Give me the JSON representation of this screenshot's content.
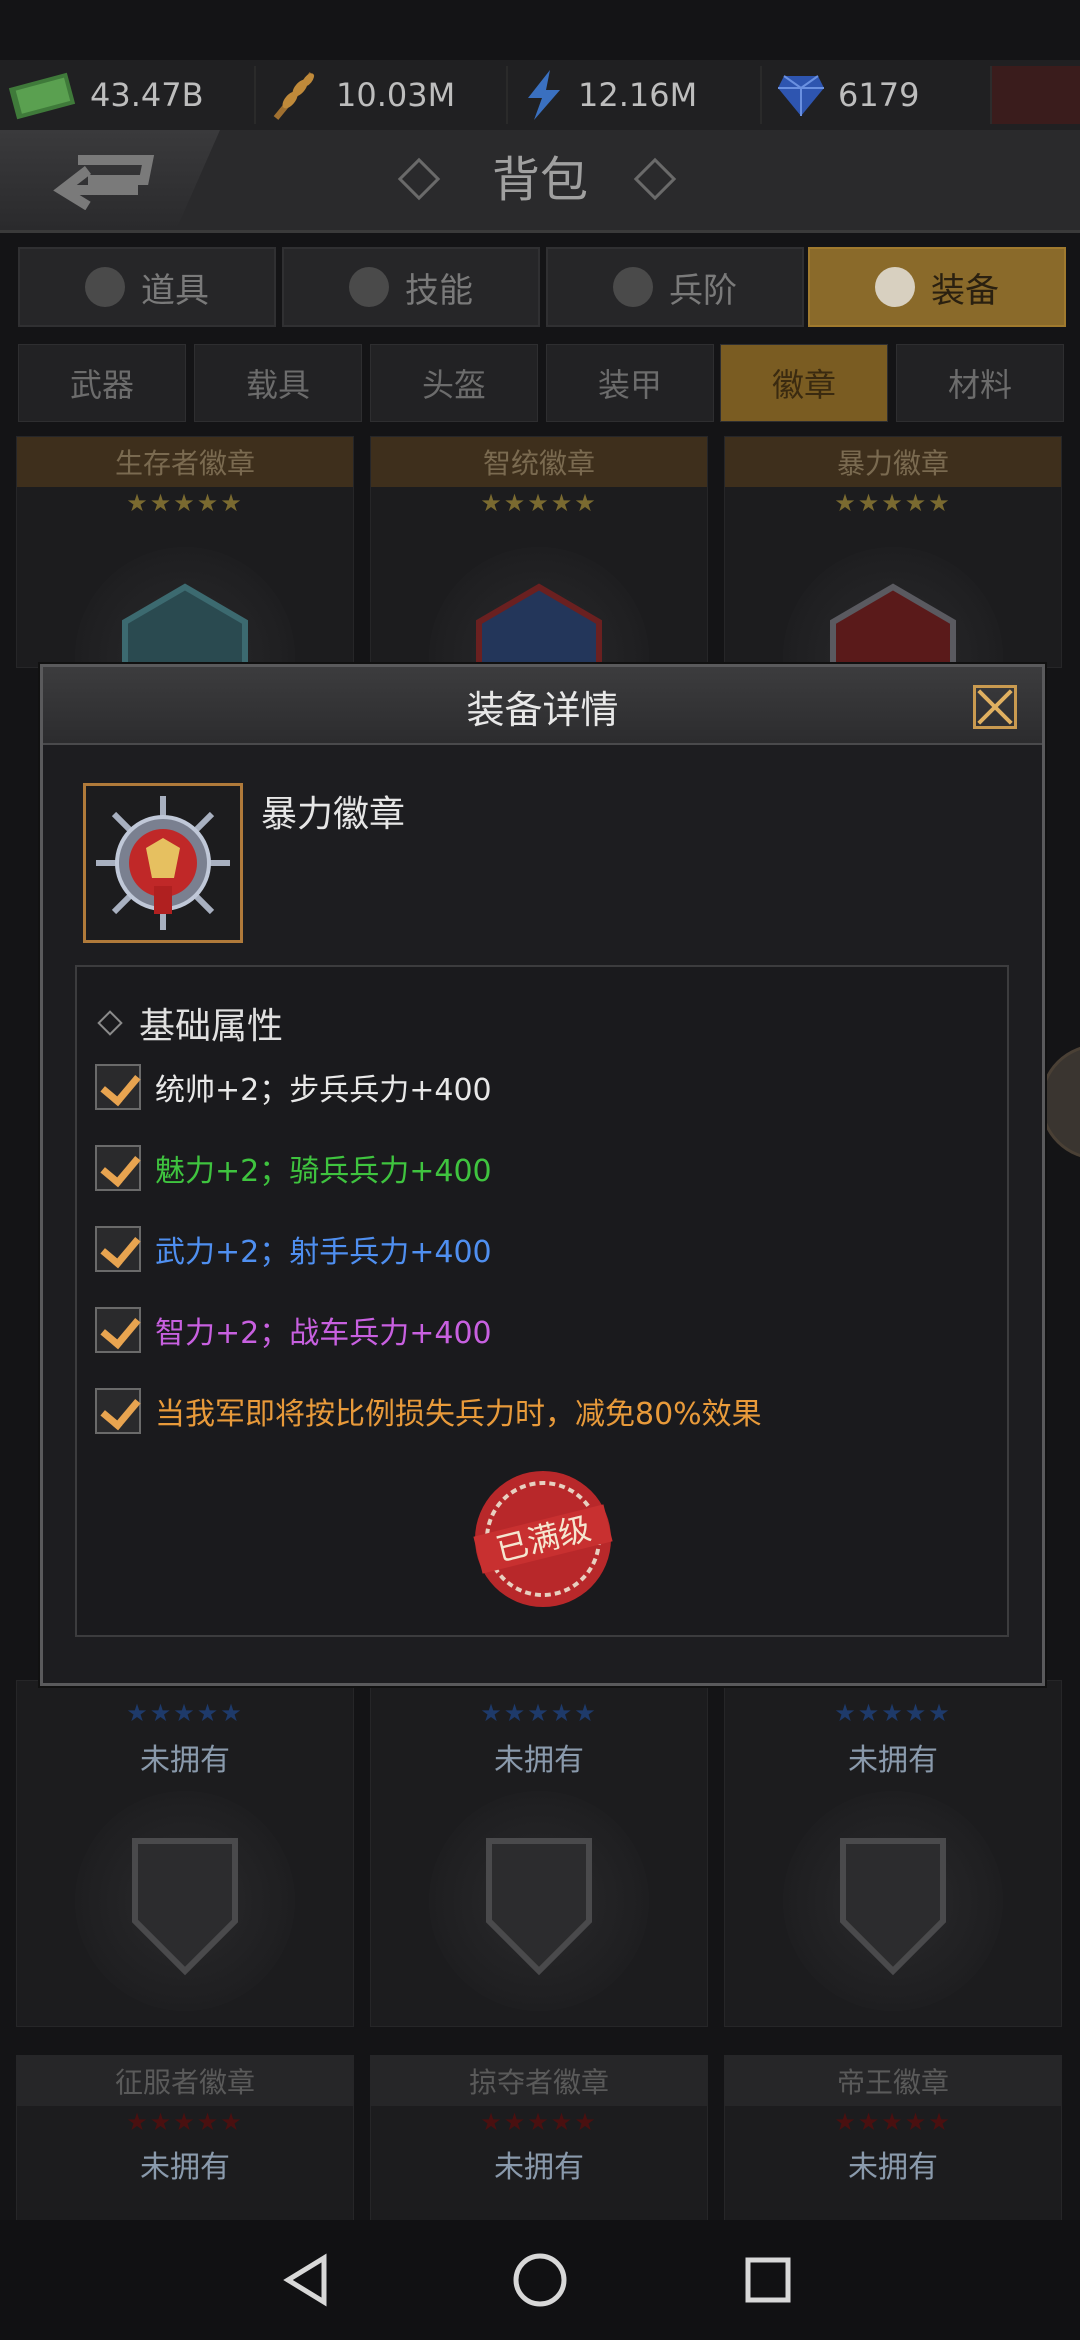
{
  "resources": [
    {
      "icon": "cash-icon",
      "value": "43.47B"
    },
    {
      "icon": "grain-icon",
      "value": "10.03M"
    },
    {
      "icon": "lightning-icon",
      "value": "12.16M"
    },
    {
      "icon": "diamond-icon",
      "value": "6179"
    }
  ],
  "header": {
    "title": "背包"
  },
  "main_tabs": [
    "道具",
    "技能",
    "兵阶",
    "装备"
  ],
  "active_main_tab": "装备",
  "sub_tabs": [
    "武器",
    "载具",
    "头盔",
    "装甲",
    "徽章",
    "材料"
  ],
  "active_sub_tab": "徽章",
  "top_cards": [
    {
      "name": "生存者徽章",
      "stars": "★★★★★"
    },
    {
      "name": "智统徽章",
      "stars": "★★★★★"
    },
    {
      "name": "暴力徽章",
      "stars": "★★★★★"
    }
  ],
  "middle_cards": [
    {
      "status": "未拥有"
    },
    {
      "status": "未拥有"
    },
    {
      "status": "未拥有"
    }
  ],
  "bottom_cards": [
    {
      "name": "征服者徽章",
      "status": "未拥有"
    },
    {
      "name": "掠夺者徽章",
      "status": "未拥有"
    },
    {
      "name": "帝王徽章",
      "status": "未拥有"
    }
  ],
  "modal": {
    "title": "装备详情",
    "item_name": "暴力徽章",
    "section_title": "基础属性",
    "attributes": [
      {
        "text": "统帅+2；步兵兵力+400",
        "color": "#e8e8e8"
      },
      {
        "text": "魅力+2；骑兵兵力+400",
        "color": "#3fc43f"
      },
      {
        "text": "武力+2；射手兵力+400",
        "color": "#4f8ff0"
      },
      {
        "text": "智力+2；战车兵力+400",
        "color": "#c860e0"
      },
      {
        "text": "当我军即将按比例损失兵力时，减免80%效果",
        "color": "#e89a3a"
      }
    ],
    "stamp_text": "已满级"
  },
  "colors": {
    "accent": "#e8a450",
    "stamp": "#c0282a"
  }
}
